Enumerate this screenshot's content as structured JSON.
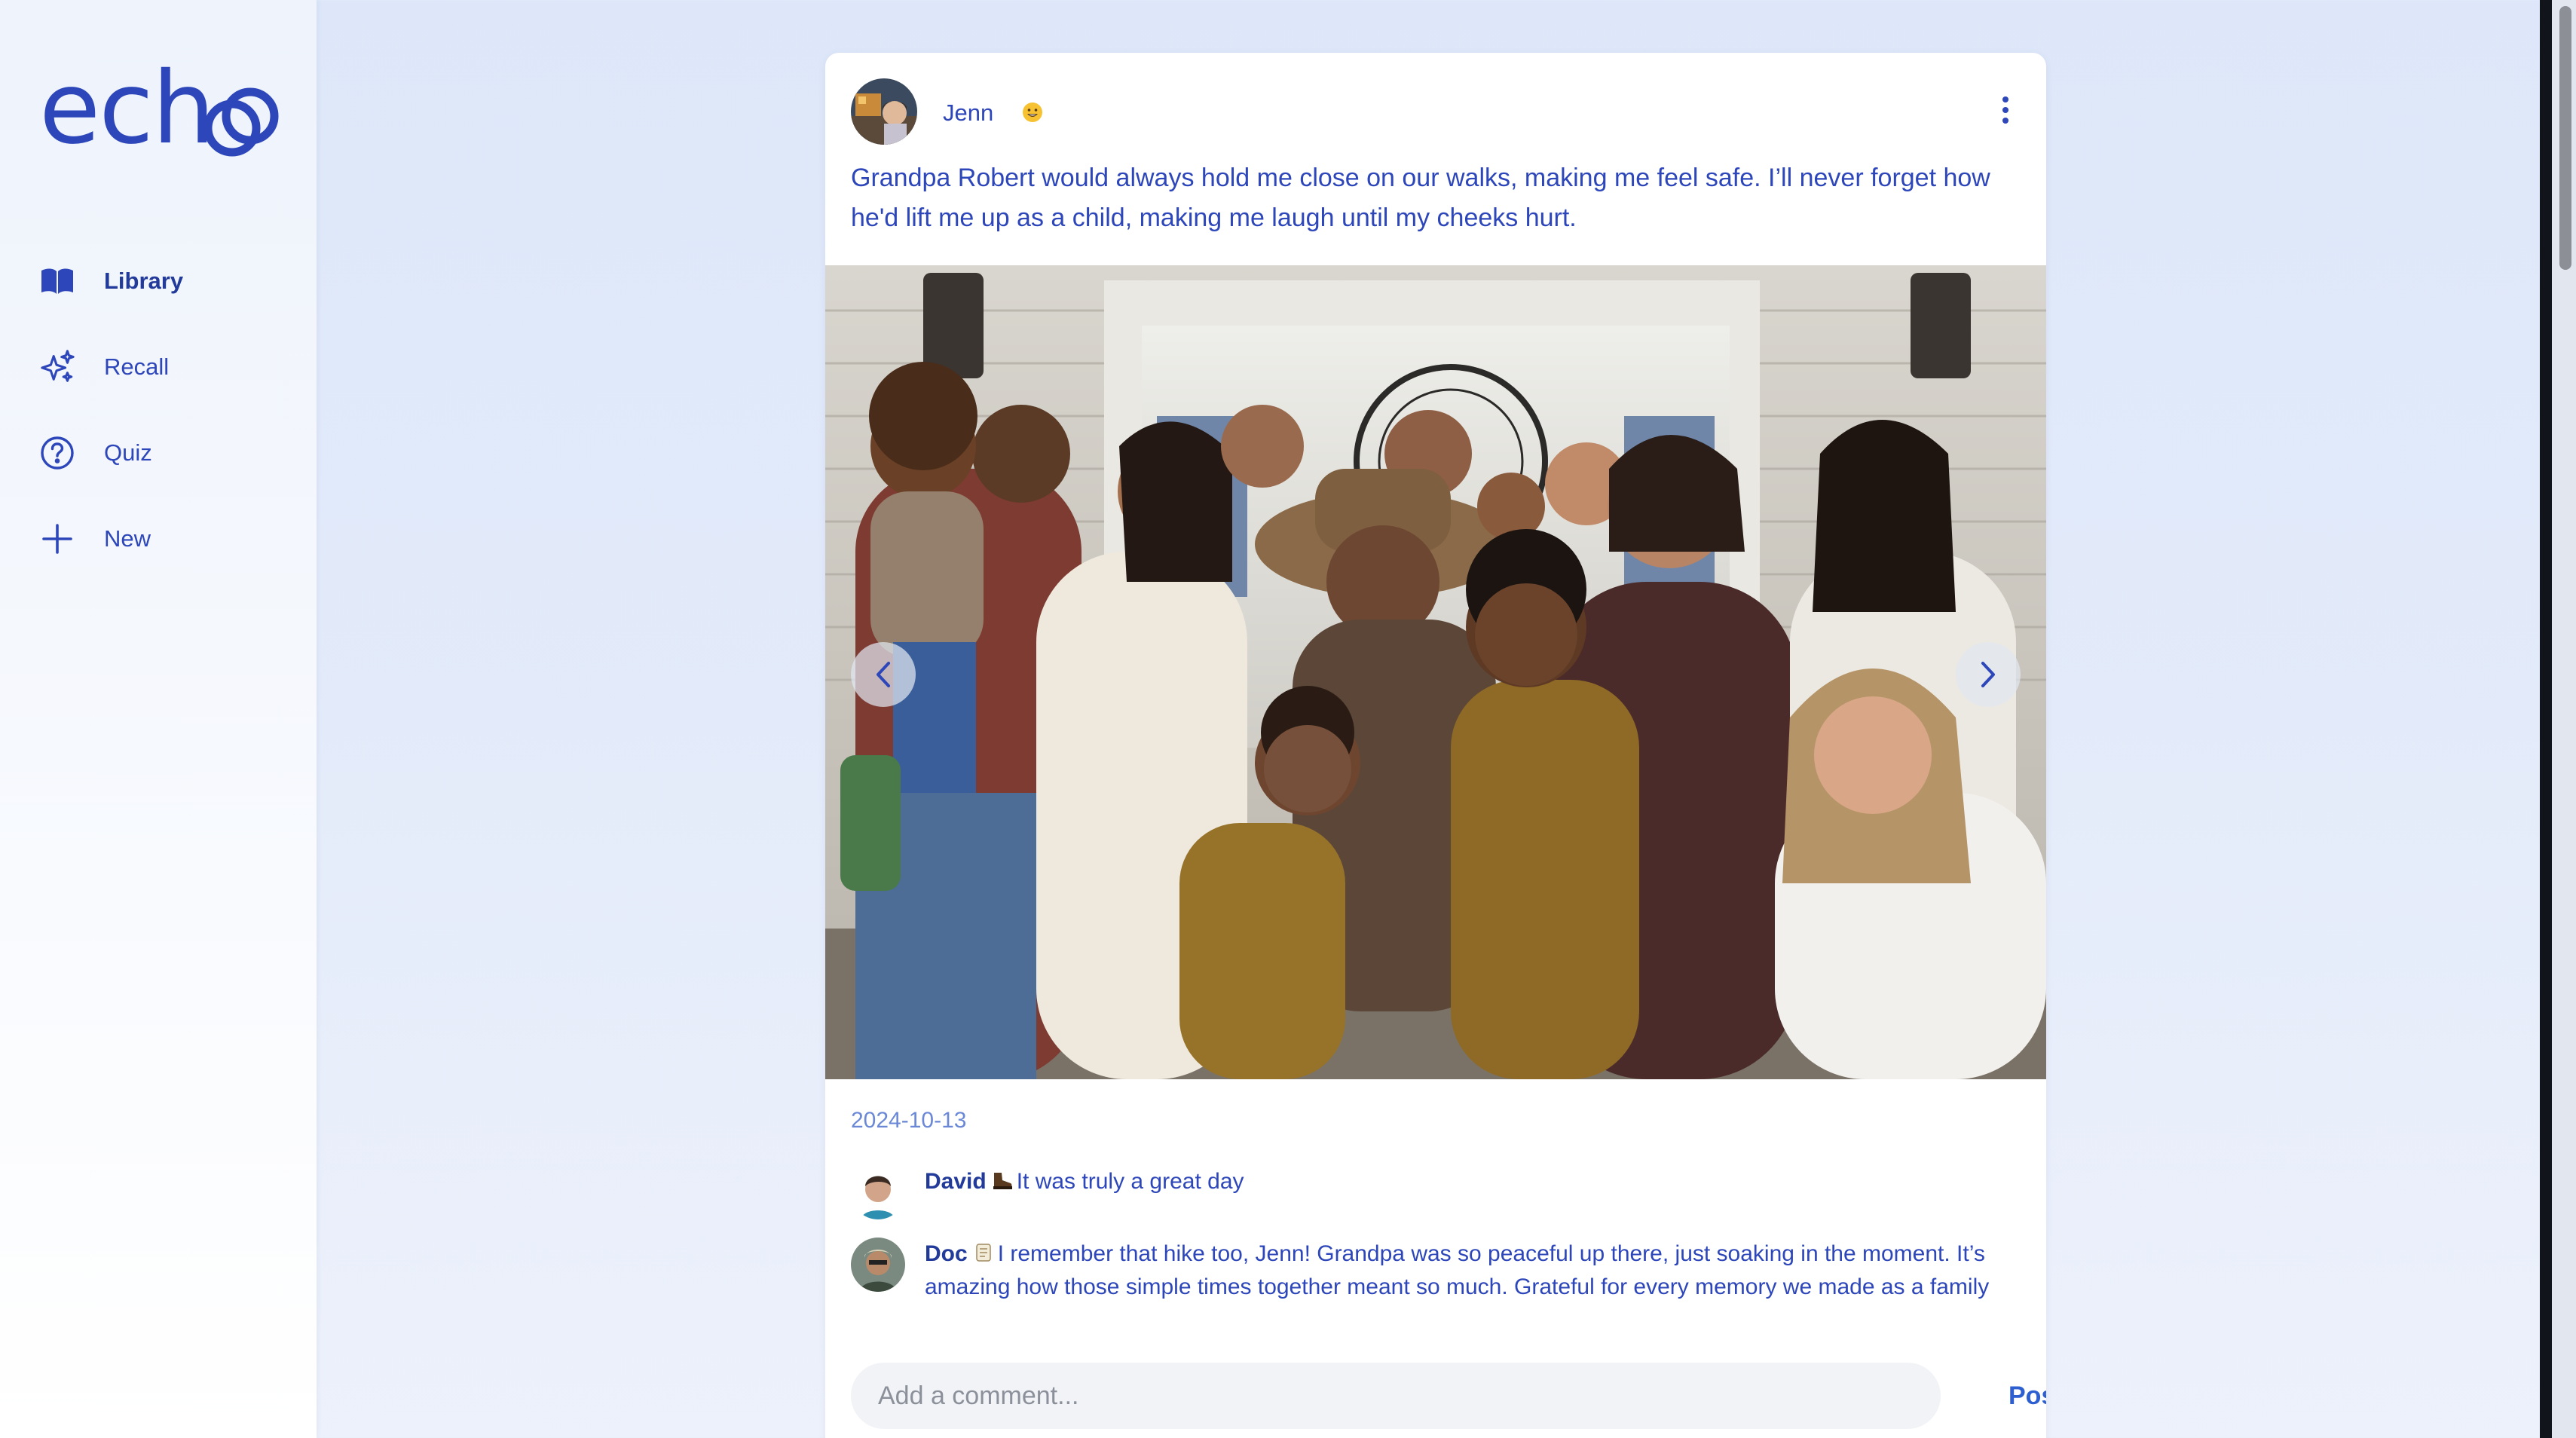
{
  "app": {
    "logo_text": "echo"
  },
  "sidebar": {
    "items": [
      {
        "label": "Library",
        "icon": "book-open-icon",
        "active": true
      },
      {
        "label": "Recall",
        "icon": "sparkles-icon",
        "active": false
      },
      {
        "label": "Quiz",
        "icon": "question-circle-icon",
        "active": false
      },
      {
        "label": "New",
        "icon": "plus-icon",
        "active": false
      }
    ]
  },
  "post": {
    "author": "Jenn",
    "author_emoji": "grinning-face-icon",
    "caption": "Grandpa Robert would always hold me close on our walks, making me feel safe. I’ll never forget how he'd lift me up as a child, making me laugh until my cheeks hurt.",
    "date": "2024-10-13",
    "carousel": {
      "current": 1,
      "total": 2
    }
  },
  "comments": [
    {
      "author": "David",
      "emoji": "hiking-boot-icon",
      "text": "It was truly a great day"
    },
    {
      "author": "Doc",
      "emoji": "scroll-icon",
      "text": "I remember that hike too, Jenn! Grandpa was so peaceful up there, just soaking in the moment. It’s amazing how those simple times together meant so much. Grateful for every memory we made as a family"
    }
  ],
  "comment_box": {
    "placeholder": "Add a comment...",
    "value": "",
    "post_label": "Post"
  },
  "colors": {
    "accent": "#2d46b9",
    "background": "#dde7f9",
    "date": "#6a88d6"
  }
}
